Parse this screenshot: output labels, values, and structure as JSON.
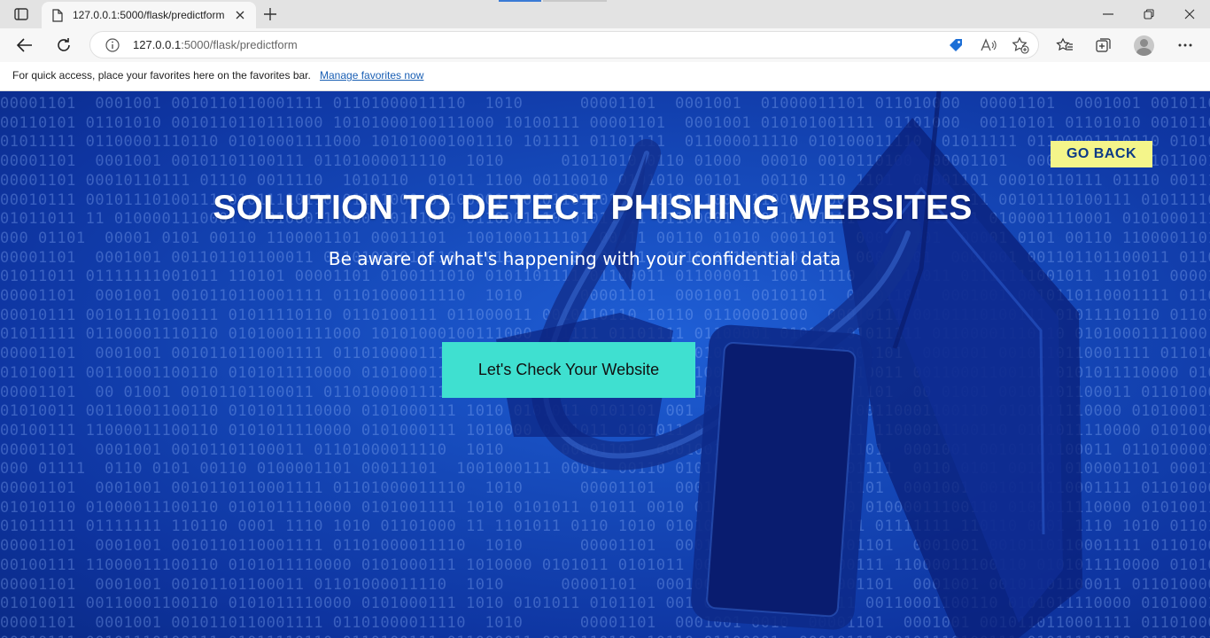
{
  "browser": {
    "tab": {
      "title": "127.0.0.1:5000/flask/predictform"
    },
    "address": {
      "host": "127.0.0.1",
      "path": ":5000/flask/predictform"
    },
    "favorites_bar": {
      "message": "For quick access, place your favorites here on the favorites bar.",
      "link": "Manage favorites now"
    },
    "icons": {
      "tab_actions": "tab-actions-icon",
      "page": "page-icon",
      "close_tab": "close-icon",
      "new_tab": "plus-icon",
      "minimize": "minimize-icon",
      "restore": "restore-icon",
      "close_window": "close-window-icon",
      "back": "back-arrow-icon",
      "refresh": "refresh-icon",
      "info": "info-icon",
      "shopping": "tag-icon",
      "read_aloud": "read-aloud-icon",
      "add_favorite": "star-plus-icon",
      "favorites": "favorites-icon",
      "collections": "collections-icon",
      "profile": "profile-avatar",
      "more": "more-icon"
    }
  },
  "page": {
    "go_back_label": "GO BACK",
    "title": "SOLUTION TO DETECT PHISHING WEBSITES",
    "subtitle": "Be aware of what's happening with your confidential data",
    "cta_label": "Let's Check Your Website",
    "colors": {
      "background": "#1548b8",
      "go_back_bg": "#f4f58a",
      "go_back_text": "#0d3a86",
      "cta_bg": "#3fe0d0"
    }
  }
}
